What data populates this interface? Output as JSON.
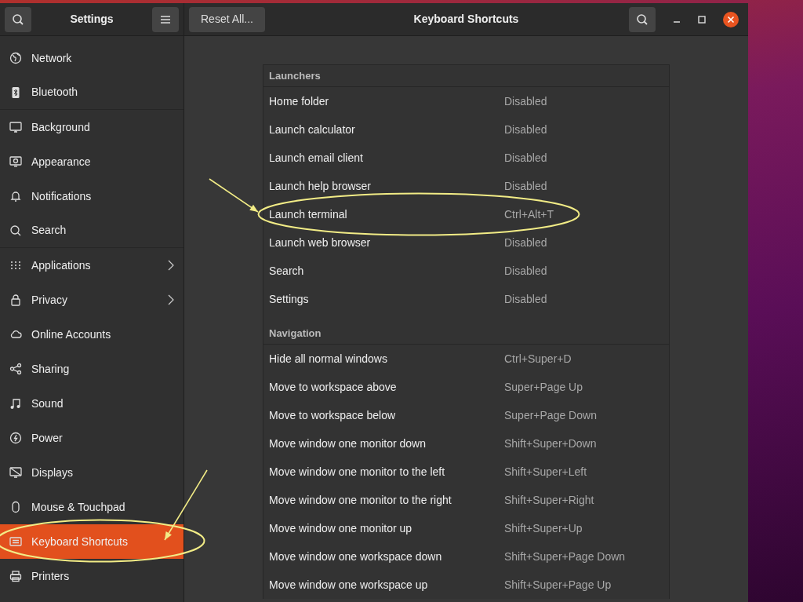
{
  "sidebar": {
    "title": "Settings",
    "items": [
      {
        "label": "Network",
        "selected": false,
        "chevron": false,
        "circled": false
      },
      {
        "label": "Bluetooth",
        "selected": false,
        "chevron": false,
        "circled": false
      },
      {
        "label": "Background",
        "selected": false,
        "chevron": false,
        "circled": false
      },
      {
        "label": "Appearance",
        "selected": false,
        "chevron": false,
        "circled": false
      },
      {
        "label": "Notifications",
        "selected": false,
        "chevron": false,
        "circled": false
      },
      {
        "label": "Search",
        "selected": false,
        "chevron": false,
        "circled": false
      },
      {
        "label": "Applications",
        "selected": false,
        "chevron": true,
        "circled": false
      },
      {
        "label": "Privacy",
        "selected": false,
        "chevron": true,
        "circled": false
      },
      {
        "label": "Online Accounts",
        "selected": false,
        "chevron": false,
        "circled": false
      },
      {
        "label": "Sharing",
        "selected": false,
        "chevron": false,
        "circled": false
      },
      {
        "label": "Sound",
        "selected": false,
        "chevron": false,
        "circled": false
      },
      {
        "label": "Power",
        "selected": false,
        "chevron": false,
        "circled": false
      },
      {
        "label": "Displays",
        "selected": false,
        "chevron": false,
        "circled": false
      },
      {
        "label": "Mouse & Touchpad",
        "selected": false,
        "chevron": false,
        "circled": false
      },
      {
        "label": "Keyboard Shortcuts",
        "selected": true,
        "chevron": false,
        "circled": true
      },
      {
        "label": "Printers",
        "selected": false,
        "chevron": false,
        "circled": false
      }
    ]
  },
  "header": {
    "reset_button": "Reset All...",
    "title": "Keyboard Shortcuts"
  },
  "sections": [
    {
      "title": "Launchers",
      "rows": [
        {
          "action": "Home folder",
          "shortcut": "Disabled",
          "circled": false
        },
        {
          "action": "Launch calculator",
          "shortcut": "Disabled",
          "circled": false
        },
        {
          "action": "Launch email client",
          "shortcut": "Disabled",
          "circled": false
        },
        {
          "action": "Launch help browser",
          "shortcut": "Disabled",
          "circled": false
        },
        {
          "action": "Launch terminal",
          "shortcut": "Ctrl+Alt+T",
          "circled": true
        },
        {
          "action": "Launch web browser",
          "shortcut": "Disabled",
          "circled": false
        },
        {
          "action": "Search",
          "shortcut": "Disabled",
          "circled": false
        },
        {
          "action": "Settings",
          "shortcut": "Disabled",
          "circled": false
        }
      ]
    },
    {
      "title": "Navigation",
      "rows": [
        {
          "action": "Hide all normal windows",
          "shortcut": "Ctrl+Super+D",
          "circled": false
        },
        {
          "action": "Move to workspace above",
          "shortcut": "Super+Page Up",
          "circled": false
        },
        {
          "action": "Move to workspace below",
          "shortcut": "Super+Page Down",
          "circled": false
        },
        {
          "action": "Move window one monitor down",
          "shortcut": "Shift+Super+Down",
          "circled": false
        },
        {
          "action": "Move window one monitor to the left",
          "shortcut": "Shift+Super+Left",
          "circled": false
        },
        {
          "action": "Move window one monitor to the right",
          "shortcut": "Shift+Super+Right",
          "circled": false
        },
        {
          "action": "Move window one monitor up",
          "shortcut": "Shift+Super+Up",
          "circled": false
        },
        {
          "action": "Move window one workspace down",
          "shortcut": "Shift+Super+Page Down",
          "circled": false
        },
        {
          "action": "Move window one workspace up",
          "shortcut": "Shift+Super+Page Up",
          "circled": false
        }
      ]
    }
  ]
}
